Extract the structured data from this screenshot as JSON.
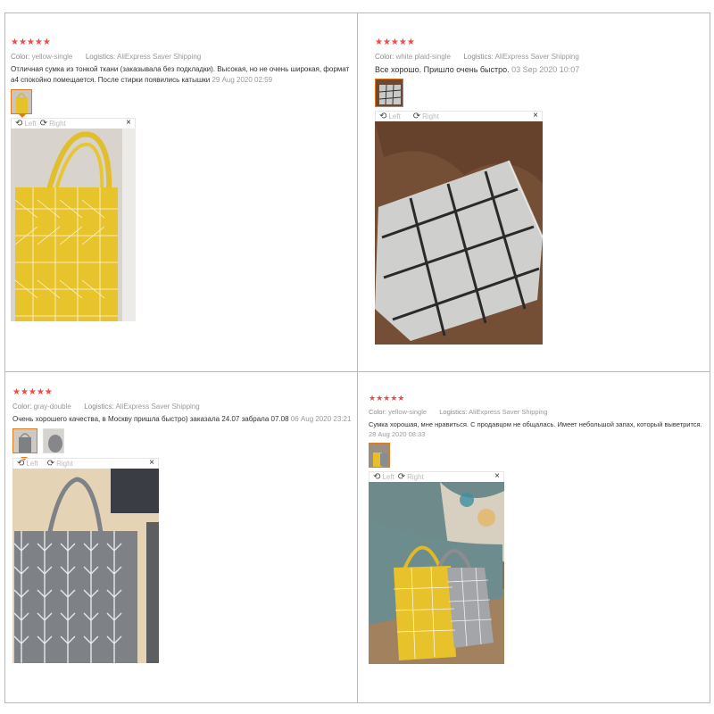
{
  "reviews": [
    {
      "stars": "★★★★★",
      "color_label": "Color:",
      "color_value": "yellow-single",
      "logistics_label": "Logistics:",
      "logistics_value": "AliExpress Saver Shipping",
      "text": "Отличная сумка из тонкой ткани (заказывала без подкладки). Высокая, но не очень широкая, формат а4 спокойно помещается. После стирки появились катышки",
      "date": "29 Aug 2020 02:59",
      "controls": {
        "left": "Left",
        "right": "Right",
        "close": "×"
      }
    },
    {
      "stars": "★★★★★",
      "color_label": "Color:",
      "color_value": "white plaid-single",
      "logistics_label": "Logistics:",
      "logistics_value": "AliExpress Saver Shipping",
      "text": "Все хорошо. Пришло очень быстро.",
      "date": "03 Sep 2020 10:07",
      "controls": {
        "left": "Left",
        "right": "Right",
        "close": "×"
      }
    },
    {
      "stars": "★★★★★",
      "color_label": "Color:",
      "color_value": "gray-double",
      "logistics_label": "Logistics:",
      "logistics_value": "AliExpress Saver Shipping",
      "text": "Очень хорошего качества, в Москву пришла быстро) заказала 24.07 забрала 07.08",
      "date": "06 Aug 2020 23:21",
      "controls": {
        "left": "Left",
        "right": "Right",
        "close": "×"
      }
    },
    {
      "stars": "★★★★★",
      "color_label": "Color:",
      "color_value": "yellow-single",
      "logistics_label": "Logistics:",
      "logistics_value": "AliExpress Saver Shipping",
      "text": "Сумка хорошая, мне нравиться. С продавцом не общалась. Имеет небольшой запах, который выветрится.",
      "date": "28 Aug 2020 08:33",
      "controls": {
        "left": "Left",
        "right": "Right",
        "close": "×"
      }
    }
  ],
  "icons": {
    "rotate_left": "rotate-left-icon",
    "rotate_right": "rotate-right-icon",
    "close": "close-icon"
  },
  "colors": {
    "stars": "#f24a4a",
    "active_thumb": "#e07a1f",
    "yellow_bag": "#e9c52a",
    "gray_bag": "#7f8286"
  }
}
